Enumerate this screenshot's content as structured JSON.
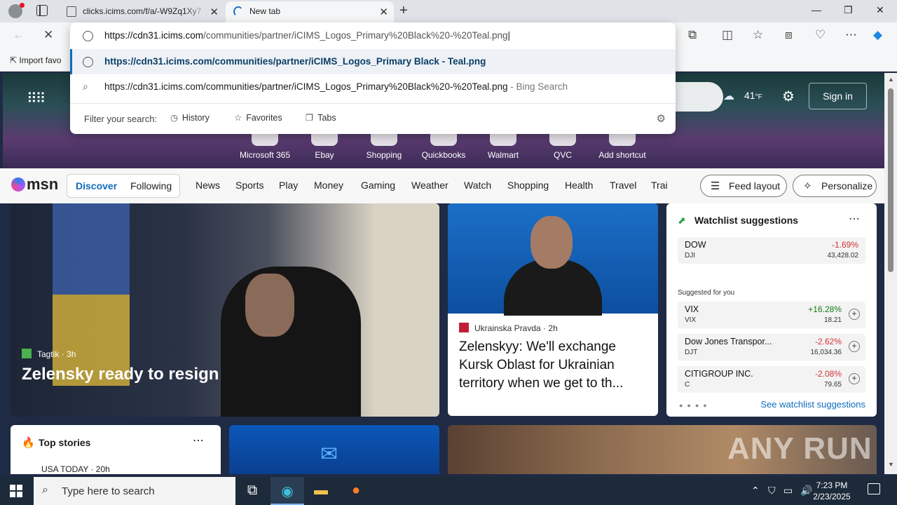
{
  "tabs": [
    {
      "title": "clicks.icims.com/f/a/-W9Zq1Xy7",
      "active": false
    },
    {
      "title": "New tab",
      "active": true
    }
  ],
  "omnibox": {
    "input_host": "https://cdn31.icims.com",
    "input_path": "/communities/partner/iCIMS_Logos_Primary%20Black%20-%20Teal.png",
    "suggestion_url": "https://cdn31.icims.com/communities/partner/iCIMS_Logos_Primary Black - Teal.png",
    "bing_query": "https://cdn31.icims.com/communities/partner/iCIMS_Logos_Primary%20Black%20-%20Teal.png",
    "bing_suffix": " - Bing Search",
    "filter_label": "Filter your search:",
    "filters": [
      "History",
      "Favorites",
      "Tabs"
    ]
  },
  "favorites_bar": {
    "import_label": "Import favo"
  },
  "hero": {
    "temperature": "41",
    "temp_unit": "°F",
    "sign_in": "Sign in",
    "shortcuts": [
      "Microsoft 365",
      "Ebay",
      "Shopping",
      "Quickbooks",
      "Walmart",
      "QVC",
      "Add shortcut"
    ]
  },
  "msn": {
    "logo": "msn",
    "segments": [
      "Discover",
      "Following"
    ],
    "nav": [
      "News",
      "Sports",
      "Play",
      "Money",
      "Gaming",
      "Weather",
      "Watch",
      "Shopping",
      "Health",
      "Travel",
      "Trai"
    ],
    "feed_layout": "Feed layout",
    "personalize": "Personalize"
  },
  "main_card": {
    "source": "Tagtik",
    "age": "3h",
    "headline": "Zelensky ready to resign"
  },
  "side_card": {
    "source": "Ukrainska Pravda",
    "age": "2h",
    "headline": "Zelenskyy: We'll exchange Kursk Oblast for Ukrainian territory when we get to th..."
  },
  "watchlist": {
    "title": "Watchlist suggestions",
    "primary": {
      "name": "DOW",
      "ticker": "DJI",
      "change": "-1.69%",
      "price": "43,428.02"
    },
    "suggested_label": "Suggested for you",
    "suggested": [
      {
        "name": "VIX",
        "ticker": "VIX",
        "change": "+16.28%",
        "price": "18.21",
        "dir": "pos"
      },
      {
        "name": "Dow Jones Transpor...",
        "ticker": "DJT",
        "change": "-2.62%",
        "price": "16,034.36",
        "dir": "neg"
      },
      {
        "name": "CITIGROUP INC.",
        "ticker": "C",
        "change": "-2.08%",
        "price": "79.65",
        "dir": "neg"
      }
    ],
    "see_all": "See watchlist suggestions"
  },
  "top_stories": {
    "title": "Top stories",
    "source": "USA TODAY · 20h"
  },
  "watermark": "ANY RUN",
  "taskbar": {
    "search_placeholder": "Type here to search",
    "time": "7:23 PM",
    "date": "2/23/2025"
  }
}
